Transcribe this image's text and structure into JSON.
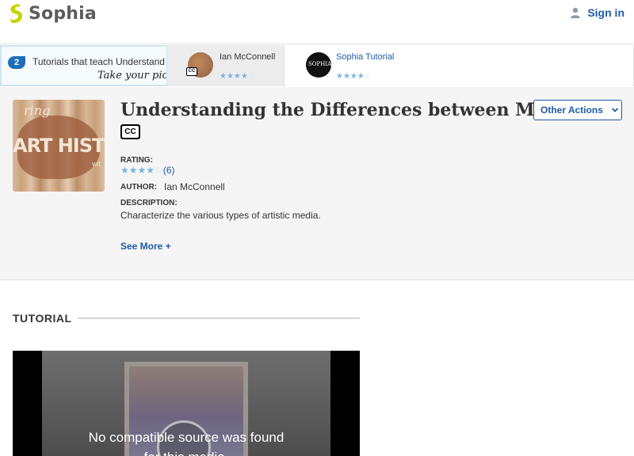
{
  "header": {
    "logo_text": "Sophia",
    "signin_label": "Sign in",
    "brand_color": "#c8d400",
    "link_color": "#1d5ba9"
  },
  "picker": {
    "count": "2",
    "intro_text": "Tutorials that teach Understand",
    "intro_pick": "Take your pick:",
    "options": [
      {
        "name": "Ian McConnell",
        "rating": 4,
        "cc": "CC"
      },
      {
        "name": "Sophia Tutorial",
        "rating": 4,
        "thumb_text": "SOPHIA"
      }
    ]
  },
  "tutorial": {
    "thumb_top": "ring",
    "thumb_text": "ART HISTORY",
    "thumb_small": "wit",
    "title": "Understanding the Differences between Media",
    "cc_label": "CC",
    "other_actions_label": "Other Actions",
    "rating_label": "RATING:",
    "rating_value": 4,
    "rating_count": "(6)",
    "author_label": "AUTHOR:",
    "author": "Ian McConnell",
    "description_label": "DESCRIPTION:",
    "description": "Characterize the various types of artistic media.",
    "see_more_label": "See More +"
  },
  "section": {
    "title": "TUTORIAL"
  },
  "video": {
    "message_line1": "No compatible source was found",
    "message_line2": "for this media."
  }
}
